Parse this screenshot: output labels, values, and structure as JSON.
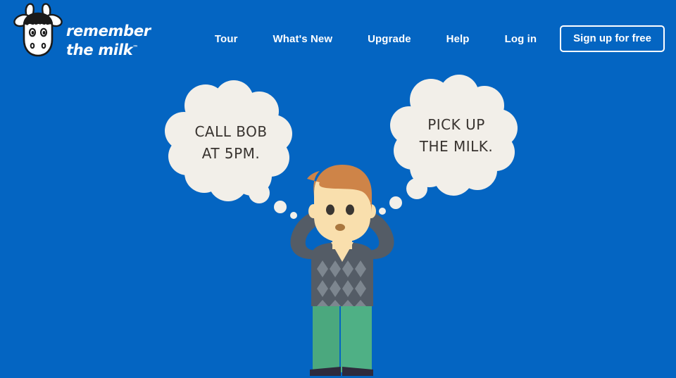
{
  "page": {
    "background_color": "#0465C2",
    "bubble_fill": "#F2EFE9",
    "bubble_text_color": "#38332F",
    "accent_white": "#FFFFFF"
  },
  "header": {
    "logo": {
      "icon": "cow-head-logo",
      "line1": "remember",
      "line2": "the milk",
      "trademark": "™"
    },
    "nav_items": [
      {
        "label": "Tour",
        "name": "nav-item-tour"
      },
      {
        "label": "What's New",
        "name": "nav-item-whats-new"
      },
      {
        "label": "Upgrade",
        "name": "nav-item-upgrade"
      },
      {
        "label": "Help",
        "name": "nav-item-help"
      },
      {
        "label": "Log in",
        "name": "nav-item-log-in"
      }
    ],
    "signup_button": {
      "label": "Sign up for free",
      "border_color": "#FFFFFF"
    }
  },
  "hero": {
    "bubble_left": {
      "text": "CALL BOB\nAT 5PM.",
      "name": "thought-bubble-left"
    },
    "bubble_right": {
      "text": "PICK UP\nTHE MILK.",
      "name": "thought-bubble-right"
    },
    "character": {
      "description": "confused-man-illustration",
      "hair_color": "#CE8448",
      "skin_color": "#F9DFAD",
      "sweater_color": "#545C66",
      "sweater_pattern_color": "#7D868F",
      "pants_color": "#4FB085",
      "shoes_color": "#2E2A3C"
    }
  }
}
